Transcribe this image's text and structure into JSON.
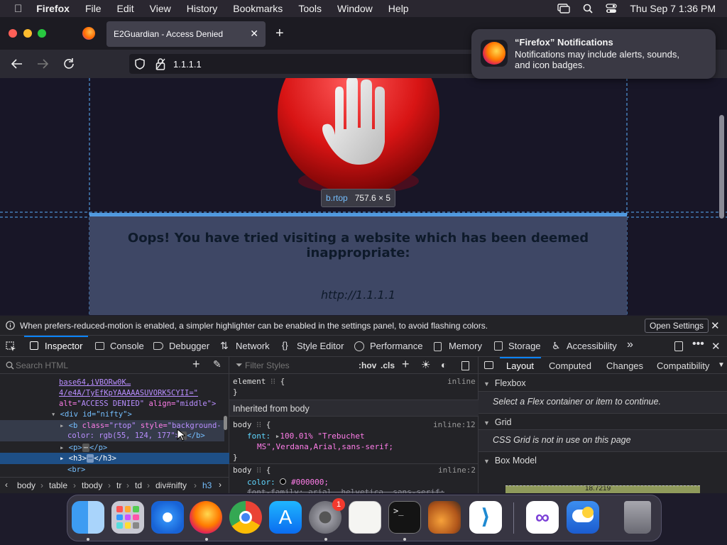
{
  "menubar": {
    "app": "Firefox",
    "items": [
      "File",
      "Edit",
      "View",
      "History",
      "Bookmarks",
      "Tools",
      "Window",
      "Help"
    ],
    "clock": "Thu Sep 7  1:36 PM"
  },
  "tab": {
    "title": "E2Guardian - Access Denied"
  },
  "url": "1.1.1.1",
  "notification": {
    "title": "“Firefox” Notifications",
    "body_line1": "Notifications may include alerts, sounds,",
    "body_line2": "and icon badges."
  },
  "page": {
    "tooltip_name": "b.rtop",
    "tooltip_size": "757.6 × 5",
    "heading": "Oops! You have tried visiting a website which has been deemed inappropriate:",
    "blocked_url": "http://1.1.1.1"
  },
  "devtools": {
    "infobar_text": "When prefers-reduced-motion is enabled, a simpler highlighter can be enabled in the settings panel, to avoid flashing colors.",
    "open_settings": "Open Settings",
    "tabs": [
      "Inspector",
      "Console",
      "Debugger",
      "Network",
      "Style Editor",
      "Performance",
      "Memory",
      "Storage",
      "Accessibility"
    ],
    "search_placeholder": "Search HTML",
    "filter_placeholder": "Filter Styles",
    "hov": ":hov",
    "cls": ".cls",
    "html_lines": {
      "l1": "base64,iVBORw0K…",
      "l2": "4/e4A/TyEfKpYAAAAASUVORK5CYII=\"",
      "l3a": "alt=",
      "l3b": "\"ACCESS DENIED\"",
      "l3c": " align=",
      "l3d": "\"middle\">",
      "l4": "<div id=\"nifty\">",
      "l5a": "<b ",
      "l5b": "class=",
      "l5c": "\"rtop\"",
      "l5d": " style=",
      "l5e": "\"background-",
      "l6": "color: rgb(55, 124, 177",
      "l6b": "\">",
      "l6c": "</b>",
      "l7": "<p>",
      "l7b": "</p>",
      "l8": "<h3>",
      "l8b": "</h3>",
      "l9": "<br>"
    },
    "breadcrumbs": [
      "body",
      "table",
      "tbody",
      "tr",
      "td",
      "div#nifty",
      "h3"
    ],
    "rules": {
      "element": "element",
      "brace_open": "{",
      "brace_close": "}",
      "inline": "inline",
      "inherited": "Inherited from body",
      "body": "body",
      "inline12": "inline:12",
      "font_prop": "font:",
      "font_val1": "100.01% \"Trebuchet",
      "font_val2": "MS\",Verdana,Arial,sans-serif;",
      "inline2": "inline:2",
      "color_prop": "color:",
      "color_val": "#000000;",
      "fontfamily_line": "font-family: arial, helvetica, sans-serif;"
    },
    "layout": {
      "tabs": [
        "Layout",
        "Computed",
        "Changes",
        "Compatibility"
      ],
      "flexbox": "Flexbox",
      "flexbox_msg": "Select a Flex container or item to continue.",
      "grid": "Grid",
      "grid_msg": "CSS Grid is not in use on this page",
      "boxmodel": "Box Model",
      "boxmodel_value": "18.7219"
    }
  },
  "dock": {
    "badge": "1",
    "apps": [
      "finder-icon",
      "launchpad-icon",
      "safari-icon",
      "firefox-icon",
      "chrome-icon",
      "app-store-icon",
      "system-settings-icon",
      "textedit-icon",
      "terminal-icon",
      "garageband-icon",
      "vscode-icon",
      "visual-studio-icon",
      "weather-icon",
      "trash-icon"
    ]
  },
  "colors": {
    "page_bg": "#181627",
    "panel": "#3e4765",
    "highlight": "#5ab0ff",
    "selected_row": "#1e4f86",
    "accent": "#0a84ff"
  }
}
